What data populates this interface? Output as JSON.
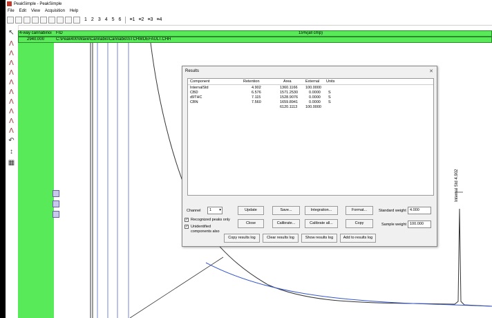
{
  "window": {
    "title": "PeakSimple - PeakSimple"
  },
  "menu": [
    "File",
    "Edit",
    "View",
    "Acquisition",
    "Help"
  ],
  "toolbar": {
    "numbers": [
      "1",
      "2",
      "3",
      "4",
      "5",
      "6"
    ],
    "stacks": [
      "1",
      "2",
      "3",
      "4"
    ]
  },
  "trace": {
    "label_top": "4-way cannabinoi",
    "label_bottom": "2940.000",
    "detector": "FID",
    "file_path": "C:\\Peak400\\Wave\\Cannabis\\Cannabis\\STCHWDEFAULT.CHH",
    "summary": "15%(all cmp)"
  },
  "peak_label": "Internal Std 4.902",
  "results_dialog": {
    "title": "Results",
    "columns": [
      "Component",
      "Retention",
      "Area",
      "External",
      "Units"
    ],
    "rows": [
      {
        "component": "InternalStd",
        "retention": "4.902",
        "area": "1360.1166",
        "external": "100.0000",
        "units": ""
      },
      {
        "component": "CBD",
        "retention": "6.576",
        "area": "1571.2530",
        "external": "0.0000",
        "units": "S"
      },
      {
        "component": "d9THC",
        "retention": "7.115",
        "area": "1528.9076",
        "external": "0.0000",
        "units": "S"
      },
      {
        "component": "CBN",
        "retention": "7.560",
        "area": "1659.8941",
        "external": "0.0000",
        "units": "S"
      },
      {
        "component": "",
        "retention": "",
        "area": "6120.1113",
        "external": "100.0000",
        "units": ""
      }
    ],
    "channel_label": "Channel",
    "channel_value": "1",
    "recognized_label": "Recognized peaks only",
    "unidentified_label": "Unidentified components also",
    "buttons": {
      "update": "Update",
      "save": "Save...",
      "integration": "Integration...",
      "format": "Format...",
      "close": "Close",
      "calibrate": "Calibrate...",
      "calibrate_all": "Calibrate all...",
      "copy": "Copy",
      "copy_log": "Copy results log",
      "clear_log": "Clear results log",
      "show_log": "Show results log",
      "add_log": "Add to results log"
    },
    "standard_weight_label": "Standard weight",
    "standard_weight_value": "4.000",
    "sample_weight_label": "Sample weight",
    "sample_weight_value": "100.000"
  },
  "colors": {
    "trace_header": "#59ea59",
    "trace": "#3355cc",
    "chrom_line": "#333333"
  }
}
